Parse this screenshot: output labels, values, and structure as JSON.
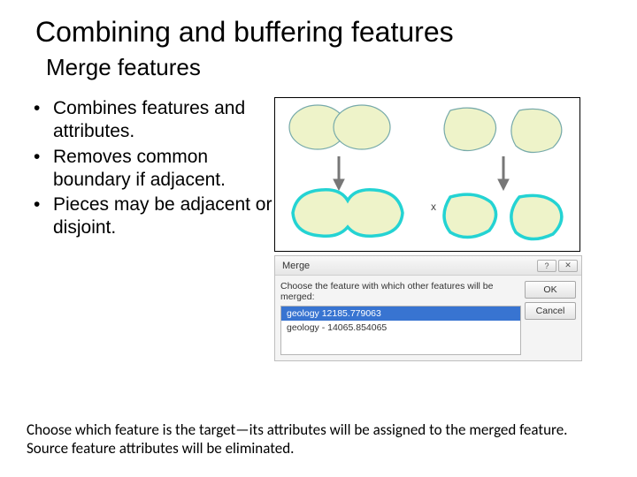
{
  "title": "Combining and buffering features",
  "subtitle": "Merge features",
  "bullets": [
    "Combines features and attributes.",
    "Removes common boundary if adjacent.",
    "Pieces may be adjacent or disjoint."
  ],
  "illustration": {
    "x_label": "x"
  },
  "dialog": {
    "title": "Merge",
    "prompt": "Choose the feature with which other features will be merged:",
    "rows": [
      "geology   12185.779063",
      "geology - 14065.854065"
    ],
    "buttons": {
      "ok": "OK",
      "cancel": "Cancel"
    },
    "help_glyph": "?",
    "close_glyph": "✕"
  },
  "footer": "Choose which feature is the target—its attributes will be assigned to the merged feature.  Source feature attributes will be eliminated."
}
